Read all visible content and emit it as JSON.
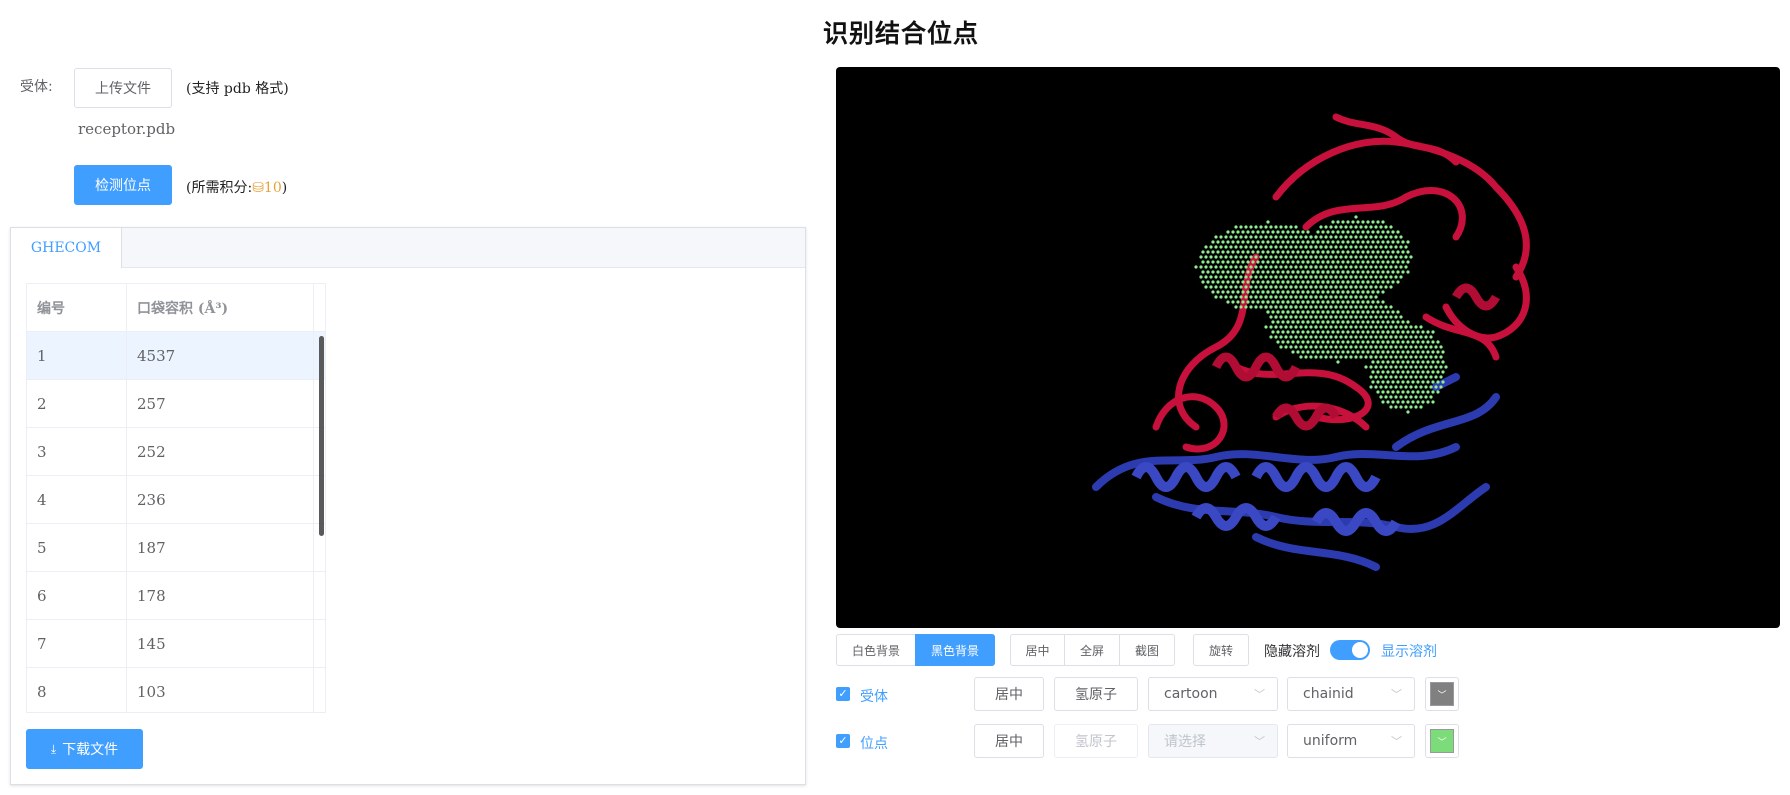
{
  "page": {
    "title": "识别结合位点"
  },
  "upload": {
    "label": "受体:",
    "button": "上传文件",
    "hint": "(支持 pdb 格式)",
    "file_name": "receptor.pdb",
    "detect_button": "检测位点",
    "points_hint_prefix": "(所需积分:",
    "points_cost": "⛁10",
    "points_hint_suffix": ")"
  },
  "results": {
    "tab": "GHECOM",
    "columns": [
      "编号",
      "口袋容积 (Å³)"
    ],
    "rows": [
      [
        "1",
        "4537"
      ],
      [
        "2",
        "257"
      ],
      [
        "3",
        "252"
      ],
      [
        "4",
        "236"
      ],
      [
        "5",
        "187"
      ],
      [
        "6",
        "178"
      ],
      [
        "7",
        "145"
      ],
      [
        "8",
        "103"
      ]
    ],
    "download_button": "下载文件"
  },
  "viewer_controls": {
    "bg_white": "白色背景",
    "bg_black": "黑色背景",
    "center": "居中",
    "fullscreen": "全屏",
    "screenshot": "截图",
    "rotate": "旋转",
    "hide_solvent": "隐藏溶剂",
    "show_solvent": "显示溶剂",
    "solvent_shown": true
  },
  "layers": [
    {
      "name": "受体",
      "checked": true,
      "center": "居中",
      "hydrogens": "氢原子",
      "style": "cartoon",
      "style_placeholder": "",
      "color_scheme": "chainid",
      "color": "#808080"
    },
    {
      "name": "位点",
      "checked": true,
      "center": "居中",
      "hydrogens": "氢原子",
      "style": "",
      "style_placeholder": "请选择",
      "color_scheme": "uniform",
      "color": "#7ddc7a"
    }
  ],
  "colors": {
    "primary": "#409eff",
    "receptor_chain_a": "#c8103c",
    "receptor_chain_b": "#2d3bb0",
    "pocket": "#90ee90"
  },
  "icons": {
    "download": "download-icon",
    "chevron": "chevron-down-icon",
    "check": "check-icon"
  }
}
